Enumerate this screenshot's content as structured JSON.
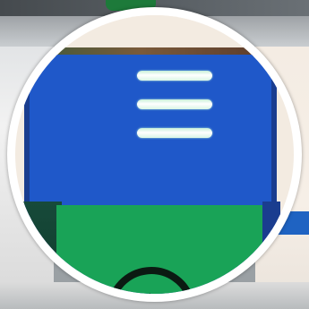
{
  "colors": {
    "panel_blue": "#1f58c9",
    "accent_green": "#19a357",
    "lens_border": "#ffffff",
    "menu_line": "#ffffff"
  },
  "icons": {
    "menu": "hamburger-menu-icon",
    "bottom": "refresh-icon"
  }
}
